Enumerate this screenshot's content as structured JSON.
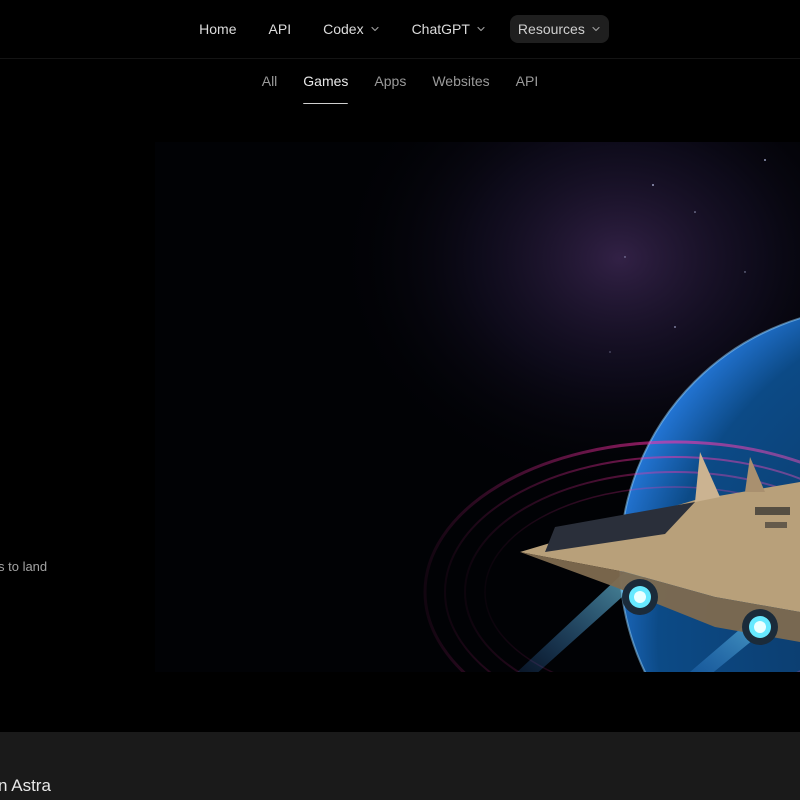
{
  "nav": {
    "items": [
      {
        "label": "Home"
      },
      {
        "label": "API"
      },
      {
        "label": "Codex"
      },
      {
        "label": "ChatGPT"
      },
      {
        "label": "Resources"
      }
    ]
  },
  "tabs": [
    {
      "label": "All"
    },
    {
      "label": "Games"
    },
    {
      "label": "Apps"
    },
    {
      "label": "Websites"
    },
    {
      "label": "API"
    }
  ],
  "hero": {
    "description_fragment": "s to land",
    "image_icon": "spaceship-orbit-illustration"
  },
  "strip": {
    "title_fragment": "n Astra"
  },
  "colors": {
    "background": "#000000",
    "nav_active_bg": "#1f1f1f",
    "strip_bg": "#1a1a1a",
    "accent_magenta": "#ff2fa8",
    "accent_cyan": "#35d8ff"
  }
}
